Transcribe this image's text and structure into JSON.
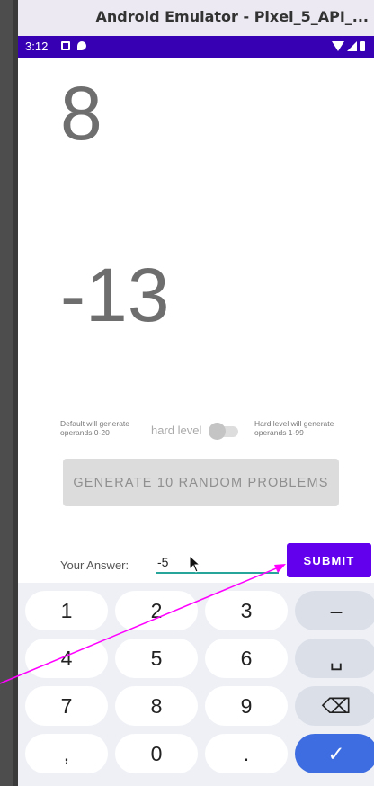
{
  "emulator": {
    "title": "Android Emulator - Pixel_5_API_..."
  },
  "status_bar": {
    "time": "3:12"
  },
  "problem": {
    "operand1": "8",
    "operand2": "-13"
  },
  "level": {
    "default_note": "Default will generate operands 0-20",
    "label": "hard level",
    "hard_note": "Hard level will generate operands 1-99",
    "hard_enabled": false
  },
  "generate_button": "GENERATE 10 RANDOM PROBLEMS",
  "answer": {
    "label": "Your Answer:",
    "value": "-5"
  },
  "submit_button": "SUBMIT",
  "keyboard": {
    "rows": [
      [
        "1",
        "2",
        "3",
        "–"
      ],
      [
        "4",
        "5",
        "6",
        "␣"
      ],
      [
        "7",
        "8",
        "9",
        "⌫"
      ],
      [
        ",",
        "0",
        ".",
        "✓"
      ]
    ]
  },
  "colors": {
    "status_bar": "#3700b3",
    "submit": "#6200ee",
    "input_underline": "#26a69a",
    "done_key": "#3d6de0",
    "pointer_line": "#ff00ff"
  }
}
